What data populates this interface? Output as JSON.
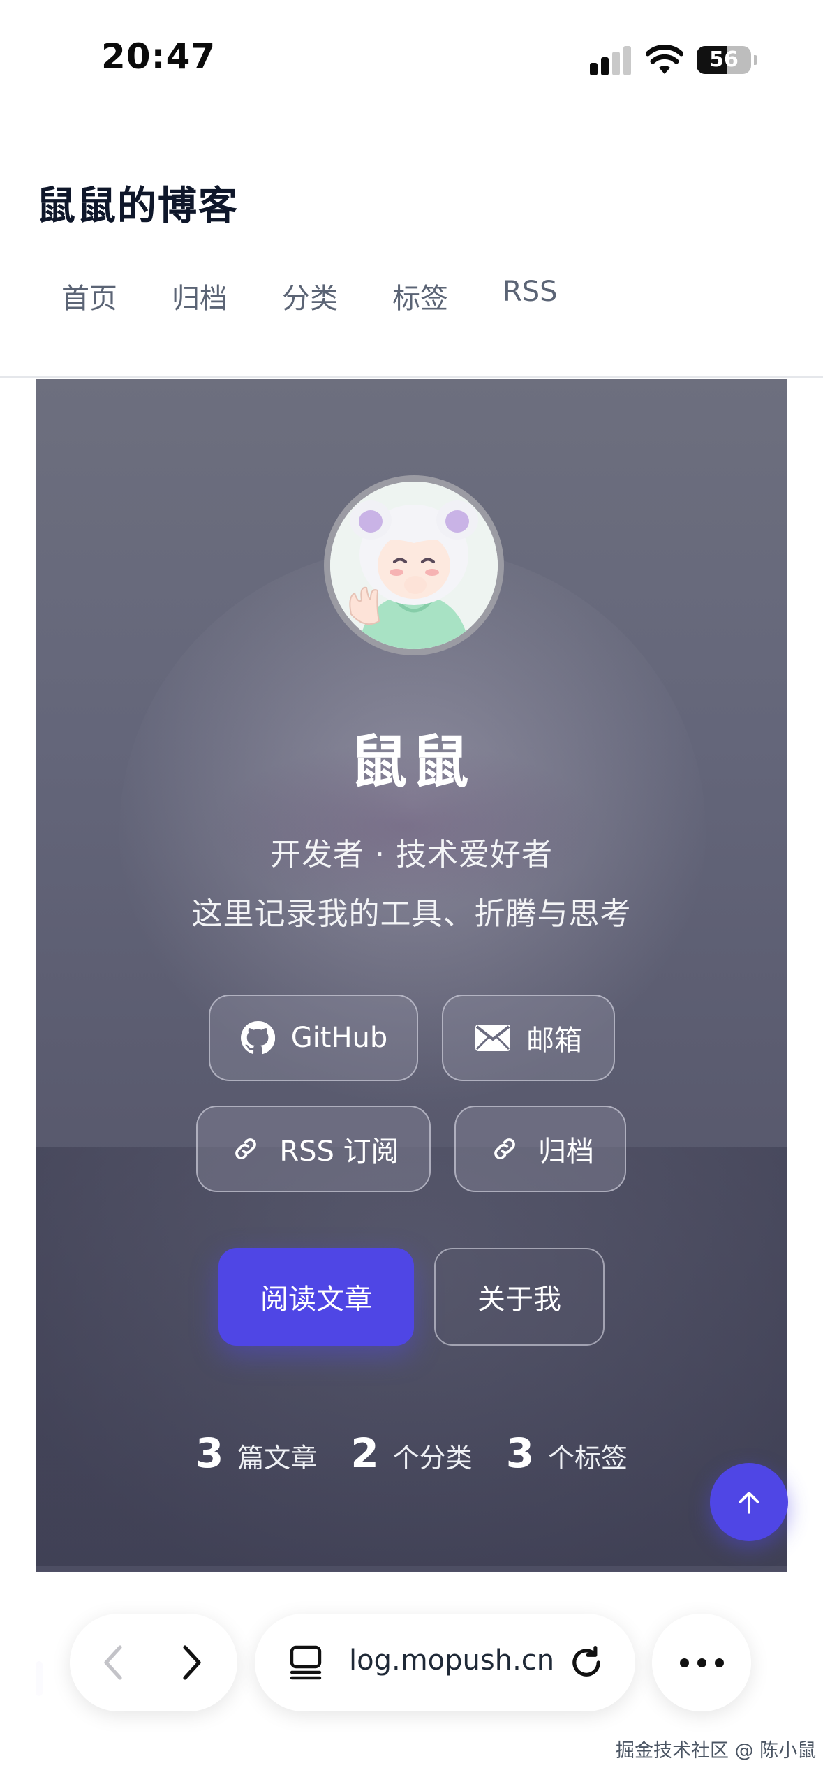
{
  "status_bar": {
    "time": "20:47",
    "battery": "56",
    "battery_level": 0.56
  },
  "header": {
    "site_title": "鼠鼠的博客",
    "nav": [
      "首页",
      "归档",
      "分类",
      "标签",
      "RSS"
    ]
  },
  "hero": {
    "name": "鼠鼠",
    "line1": "开发者 · 技术爱好者",
    "line2": "这里记录我的工具、折腾与思考",
    "links": {
      "github": "GitHub",
      "email": "邮箱",
      "rss": "RSS 订阅",
      "archive": "归档"
    },
    "primary_button": "阅读文章",
    "secondary_button": "关于我",
    "stats": [
      {
        "num": "3",
        "label": "篇文章"
      },
      {
        "num": "2",
        "label": "个分类"
      },
      {
        "num": "3",
        "label": "个标签"
      }
    ]
  },
  "browser": {
    "url": "log.mopush.cn"
  },
  "watermark": "掘金技术社区 @ 陈小鼠",
  "colors": {
    "accent": "#4f46e5",
    "nav_text": "#5b6475",
    "title": "#0f172a"
  }
}
